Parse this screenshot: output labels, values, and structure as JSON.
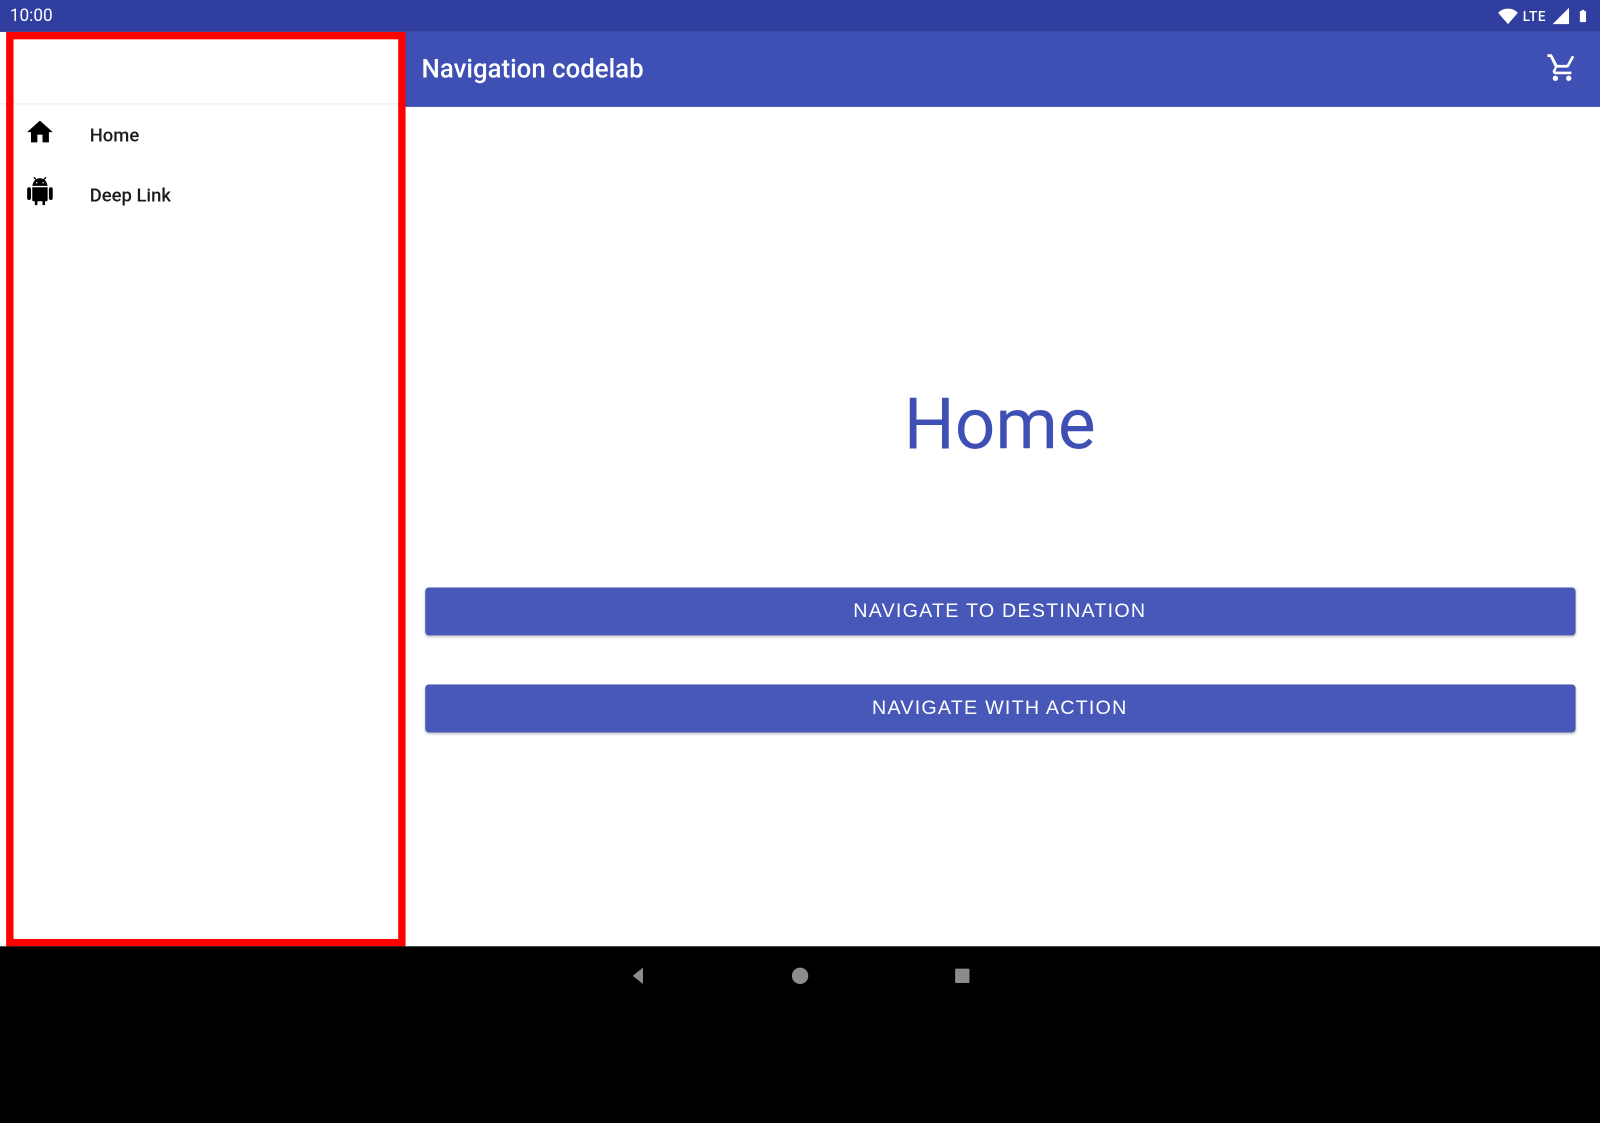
{
  "statusbar": {
    "time": "10:00",
    "network_label": "LTE"
  },
  "drawer": {
    "items": [
      {
        "label": "Home"
      },
      {
        "label": "Deep Link"
      }
    ]
  },
  "toolbar": {
    "title": "Navigation codelab"
  },
  "page": {
    "heading": "Home",
    "buttons": [
      "NAVIGATE TO DESTINATION",
      "NAVIGATE WITH ACTION"
    ]
  }
}
